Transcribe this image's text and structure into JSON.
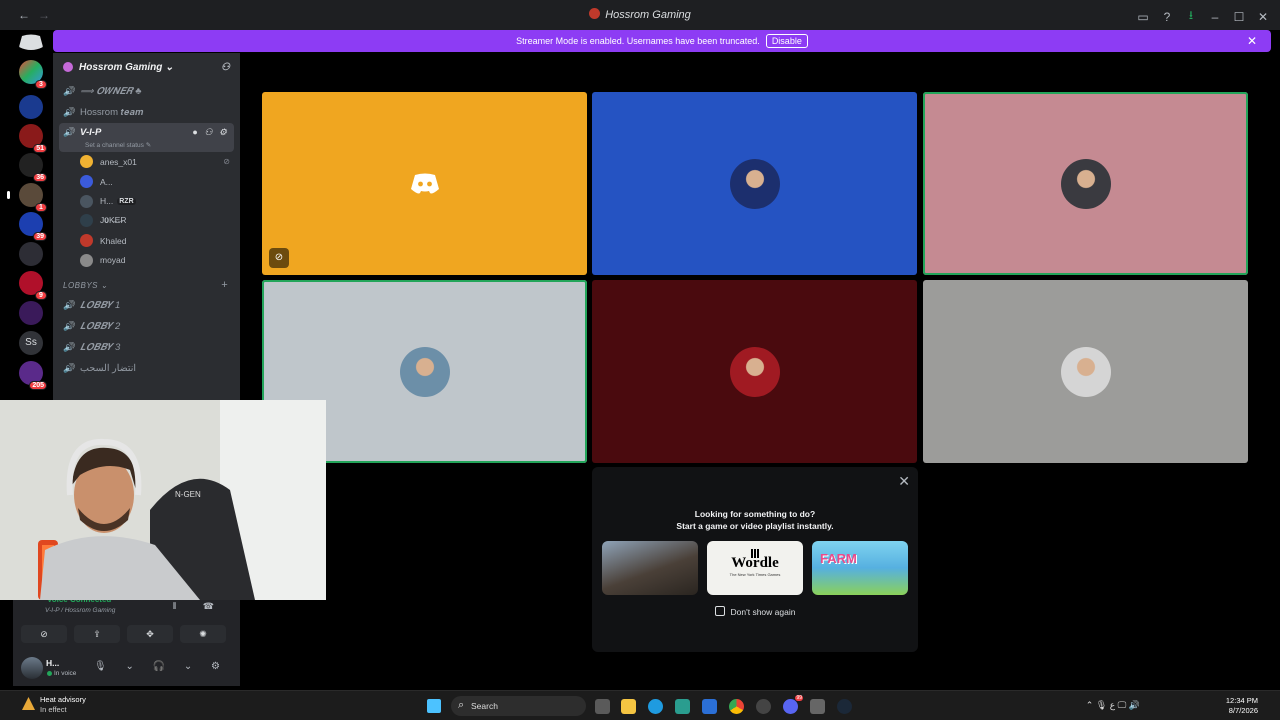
{
  "window": {
    "title": "Hossrom Gaming",
    "back_label": "←",
    "forward_label": "→",
    "icons": [
      "inbox-icon",
      "help-icon",
      "download-icon",
      "minimize-icon",
      "maximize-icon",
      "close-icon"
    ],
    "icon_glyphs": [
      "▭",
      "?",
      "⭳",
      "–",
      "☐",
      "✕"
    ]
  },
  "banner": {
    "text": "Streamer Mode is enabled. Usernames have been truncated.",
    "button": "Disable",
    "close": "✕"
  },
  "server_rail": {
    "badges": [
      "3",
      "",
      "51",
      "36",
      "1",
      "39",
      "",
      "9",
      "",
      "",
      "205"
    ],
    "letters_server": "Ss"
  },
  "server": {
    "name": "Hossrom Gaming ⌄",
    "add_user": "⚇"
  },
  "channels": {
    "owner": "⟹ 𝑶𝑾𝑵𝑬𝑹 ♣",
    "team": "Hossrom 𝒕𝒆𝒂𝒎",
    "vip": "V-I-P",
    "vip_status": "Set a channel status ✎",
    "vip_tools": "● ⚇ ⚙"
  },
  "members": [
    {
      "name": "anes_x01",
      "tag": "",
      "mute": "⊘",
      "color": "#f0b232"
    },
    {
      "name": "A...",
      "tag": "",
      "mute": "",
      "color": "#3b5bdb"
    },
    {
      "name": "H...",
      "tag": "RZR",
      "mute": "",
      "color": "#4a5560"
    },
    {
      "name": "J𝟎K̶E̶R",
      "tag": "",
      "mute": "",
      "color": "#2f3f4a"
    },
    {
      "name": "Khaled",
      "tag": "",
      "mute": "",
      "color": "#c0392b"
    },
    {
      "name": "moyad",
      "tag": "",
      "mute": "",
      "color": "#8a8a8a"
    }
  ],
  "lobbies": {
    "category": "LOBBYS ⌄",
    "plus": "+",
    "items": [
      "𝑳𝑶𝑩𝑩𝒀 1",
      "𝑳𝑶𝑩𝑩𝒀 2",
      "𝑳𝑶𝑩𝑩𝒀 3",
      "انتضار السحب"
    ]
  },
  "tiles": [
    {
      "bg": "#f0a620",
      "speaking": false,
      "kind": "discord"
    },
    {
      "bg": "#2553c2",
      "speaking": false,
      "kind": "avatar",
      "av": "#1c2f6e"
    },
    {
      "bg": "#c58a92",
      "speaking": true,
      "kind": "avatar",
      "av": "#3a3a40"
    },
    {
      "bg": "#bfc6cb",
      "speaking": true,
      "kind": "avatar",
      "av": "#6c8fa8"
    },
    {
      "bg": "#4a0a0e",
      "speaking": false,
      "kind": "avatar",
      "av": "#a01a22"
    },
    {
      "bg": "#9c9c9a",
      "speaking": false,
      "kind": "avatar",
      "av": "#d5d5d5"
    }
  ],
  "activity": {
    "heading": "Looking for something to do?",
    "subheading": "Start a game or video playlist instantly.",
    "wordle_title": "Wordle",
    "wordle_sub": "The New York Times Games",
    "farm_title": "FARM",
    "dont_show": "Don't show again"
  },
  "voice": {
    "status": "Voice Connected",
    "channel": "V-I-P / Hossrom Gaming",
    "buttons": [
      "⊘",
      "⇪",
      "✥",
      "✺"
    ],
    "icons": "⦀ ☎"
  },
  "user": {
    "name": "H...",
    "status": "In voice",
    "icons": "🎙 ⌄ 🎧 ⌄ ⚙"
  },
  "taskbar": {
    "weather_title": "Heat advisory",
    "weather_sub": "In effect",
    "search": "Search",
    "discord_badge": "99",
    "tray": "⌃ 🎙 ع 🖵 🔊",
    "time": "12:34 PM",
    "date": "8/7/2026"
  }
}
